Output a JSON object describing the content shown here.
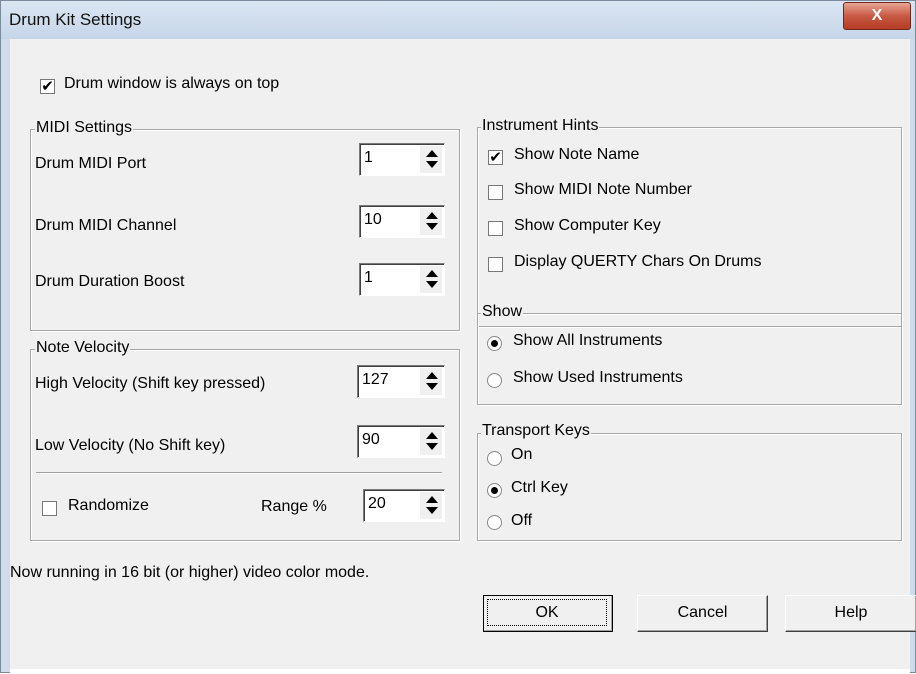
{
  "window": {
    "title": "Drum Kit Settings",
    "close_label": "X"
  },
  "always_on_top": {
    "label": "Drum window is always on top",
    "checked": true
  },
  "midi_settings": {
    "title": "MIDI Settings",
    "port": {
      "label": "Drum MIDI Port",
      "value": "1"
    },
    "channel": {
      "label": "Drum MIDI Channel",
      "value": "10"
    },
    "boost": {
      "label": "Drum Duration Boost",
      "value": "1"
    }
  },
  "note_velocity": {
    "title": "Note Velocity",
    "high": {
      "label": "High Velocity (Shift key pressed)",
      "value": "127"
    },
    "low": {
      "label": "Low Velocity (No Shift key)",
      "value": "90"
    },
    "randomize": {
      "label": "Randomize",
      "checked": false
    },
    "range": {
      "label": "Range %",
      "value": "20"
    }
  },
  "instrument_hints": {
    "title": "Instrument Hints",
    "items": [
      {
        "label": "Show Note Name",
        "checked": true
      },
      {
        "label": "Show MIDI Note Number",
        "checked": false
      },
      {
        "label": "Show Computer Key",
        "checked": false
      },
      {
        "label": "Display QUERTY Chars On Drums",
        "checked": false
      }
    ]
  },
  "show": {
    "title": "Show",
    "options": [
      {
        "label": "Show All Instruments",
        "selected": true
      },
      {
        "label": "Show Used Instruments",
        "selected": false
      }
    ]
  },
  "transport_keys": {
    "title": "Transport Keys",
    "options": [
      {
        "label": "On",
        "selected": false
      },
      {
        "label": "Ctrl Key",
        "selected": true
      },
      {
        "label": "Off",
        "selected": false
      }
    ]
  },
  "status_text": "Now running in 16 bit (or higher) video color mode.",
  "buttons": {
    "ok": "OK",
    "cancel": "Cancel",
    "help": "Help"
  }
}
